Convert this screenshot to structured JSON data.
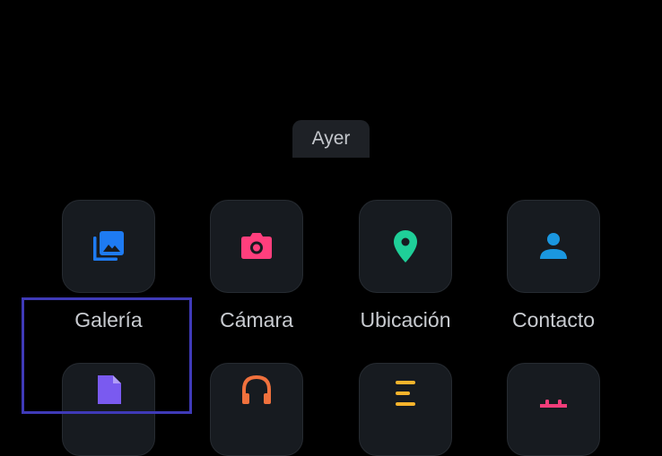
{
  "date_chip": {
    "label": "Ayer"
  },
  "attach_options": [
    {
      "label": "Galería",
      "icon": "gallery-icon",
      "color": "#1e7bf2"
    },
    {
      "label": "Cámara",
      "icon": "camera-icon",
      "color": "#ff3f7d"
    },
    {
      "label": "Ubicación",
      "icon": "location-pin-icon",
      "color": "#1fcf98"
    },
    {
      "label": "Contacto",
      "icon": "person-icon",
      "color": "#1a97e0"
    }
  ],
  "second_row_icons": [
    {
      "icon": "document-icon",
      "color": "#7a5af0"
    },
    {
      "icon": "headphones-icon",
      "color": "#f0713d"
    },
    {
      "icon": "poll-icon",
      "color": "#f7b42c"
    },
    {
      "icon": "calendar-icon",
      "color": "#f23d7a"
    }
  ]
}
